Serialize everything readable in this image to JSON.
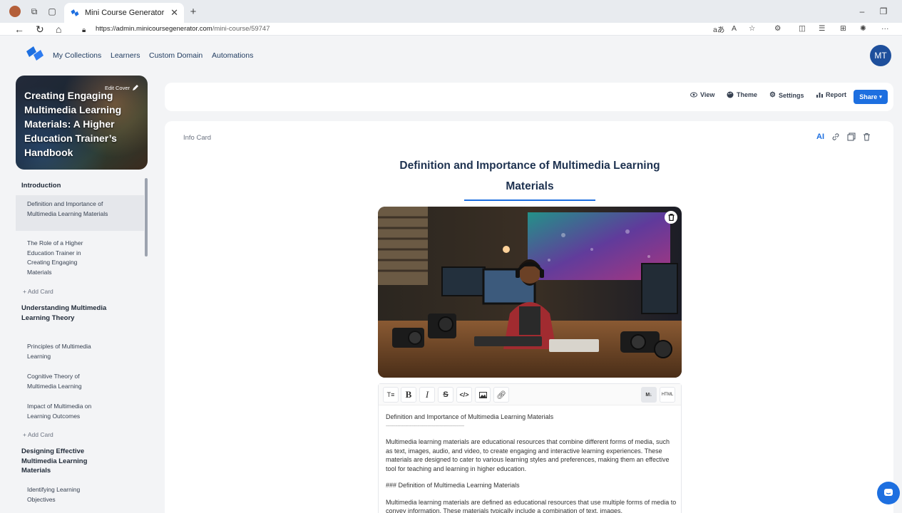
{
  "browser": {
    "tab_title": "Mini Course Generator",
    "url_host": "https://admin.minicoursegenerator.com",
    "url_path": "/mini-course/59747"
  },
  "nav": {
    "links": [
      "My Collections",
      "Learners",
      "Custom Domain",
      "Automations"
    ],
    "avatar": "MT"
  },
  "cover": {
    "edit_label": "Edit Cover",
    "title": "Creating Engaging Multimedia Learning Materials: A Higher Education Trainer’s Handbook"
  },
  "sidebar": {
    "sections": [
      {
        "title": "Introduction"
      },
      {
        "title": "Understanding Multimedia Learning Theory"
      },
      {
        "title": "Designing Effective Multimedia Learning Materials"
      }
    ],
    "items": [
      "Definition and Importance of Multimedia Learning Materials",
      "The Role of a Higher Education Trainer in Creating Engaging Materials",
      "Principles of Multimedia Learning",
      "Cognitive Theory of Multimedia Learning",
      "Impact of Multimedia on Learning Outcomes",
      "Identifying Learning Objectives"
    ],
    "add_card": "+ Add Card"
  },
  "toolbar": {
    "view": "View",
    "theme": "Theme",
    "settings": "Settings",
    "report": "Report",
    "share": "Share"
  },
  "card": {
    "type_label": "Info Card",
    "ai_label": "AI",
    "title": "Definition and Importance of Multimedia Learning Materials"
  },
  "editor": {
    "heading": "Definition and Importance of Multimedia Learning Materials",
    "underline": "------------------------------------------------------------",
    "p1": "Multimedia learning materials are educational resources that combine different forms of media, such as text, images, audio, and video, to create engaging and interactive learning experiences. These materials are designed to cater to various learning styles and preferences, making them an effective tool for teaching and learning in higher education.",
    "h3": "### Definition of Multimedia Learning Materials",
    "p2": "Multimedia learning materials are defined as educational resources that use multiple forms of media to convey information. These materials typically include a combination of text, images,"
  },
  "colors": {
    "accent": "#1d6fe0",
    "title": "#1e3250"
  }
}
